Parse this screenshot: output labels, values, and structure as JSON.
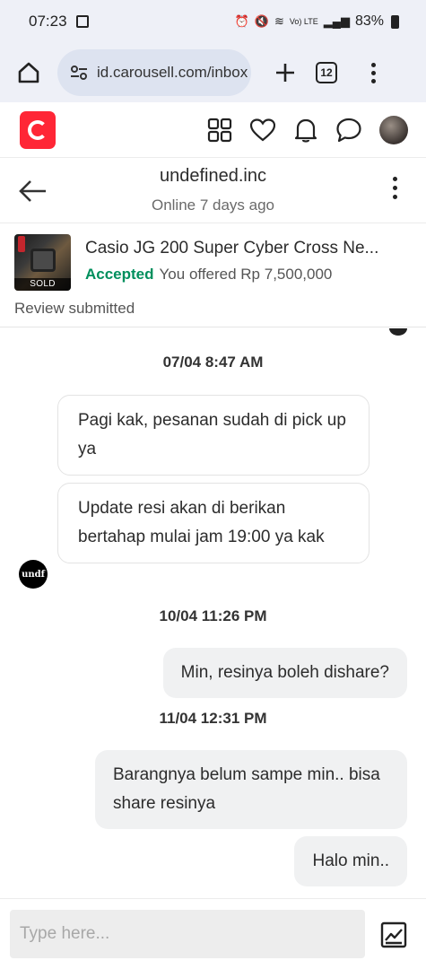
{
  "status_bar": {
    "time": "07:23",
    "network": "Vo) LTE",
    "battery": "83%"
  },
  "browser": {
    "url": "id.carousell.com/inbox",
    "tab_count": "12"
  },
  "chat": {
    "username": "undefined.inc",
    "status": "Online 7 days ago"
  },
  "product": {
    "title": "Casio JG 200 Super Cyber Cross Ne...",
    "offer_status": "Accepted",
    "offer_text": "You offered Rp 7,500,000",
    "sold_label": "SOLD",
    "review": "Review submitted"
  },
  "messages": {
    "date1": "07/04  8:47 AM",
    "m1": "Pagi kak, pesanan sudah di pick up ya",
    "m2": "Update resi akan di berikan bertahap mulai jam 19:00 ya kak",
    "avatar_text": "undf",
    "date2": "10/04  11:26 PM",
    "m3": "Min, resinya boleh dishare?",
    "date3": "11/04  12:31 PM",
    "m4": "Barangnya belum sampe min.. bisa share resinya",
    "m5": "Halo min.."
  },
  "input": {
    "placeholder": "Type here..."
  },
  "colors": {
    "brand": "#ff2636",
    "accepted": "#008f5d",
    "browser_chrome": "#eef0f7"
  }
}
